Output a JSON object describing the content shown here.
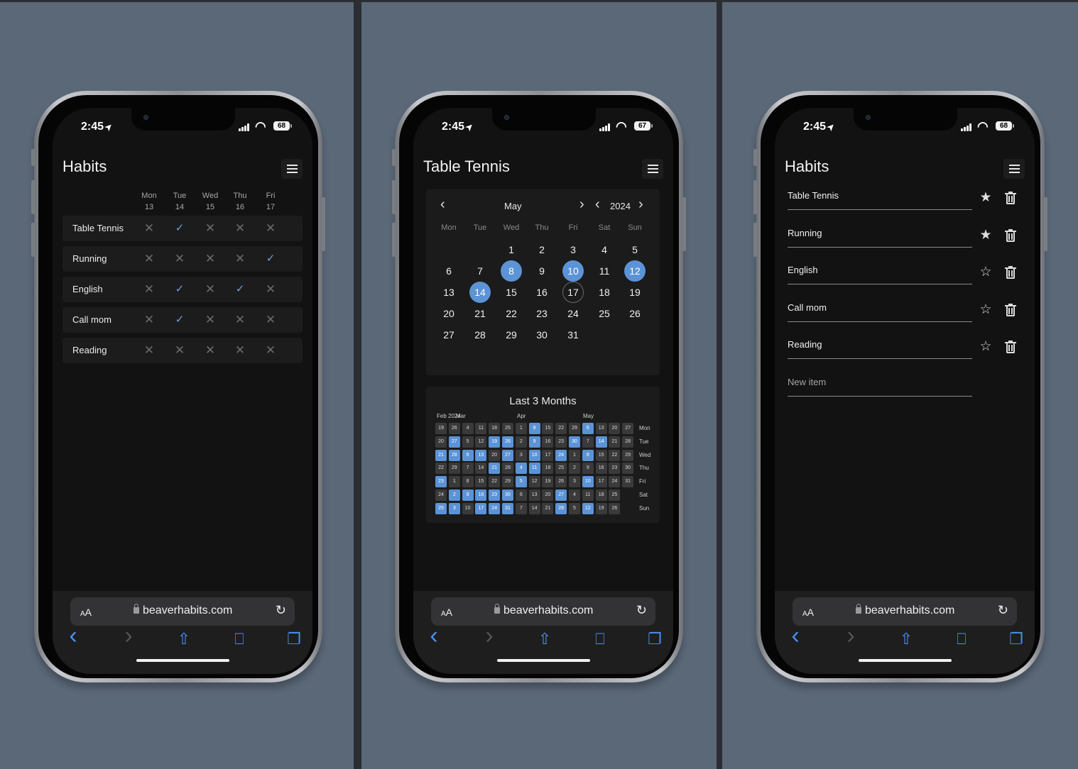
{
  "status": {
    "time": "2:45",
    "location_icon": "location-arrow-icon",
    "batteries": [
      "68",
      "67",
      "68"
    ]
  },
  "safari": {
    "aa_big": "A",
    "aa_small": "A",
    "url": "beaverhabits.com",
    "reload_icon": "reload-icon"
  },
  "screen1": {
    "title": "Habits",
    "days": [
      {
        "name": "Mon",
        "num": "13"
      },
      {
        "name": "Tue",
        "num": "14"
      },
      {
        "name": "Wed",
        "num": "15"
      },
      {
        "name": "Thu",
        "num": "16"
      },
      {
        "name": "Fri",
        "num": "17"
      }
    ],
    "habits": [
      {
        "name": "Table Tennis",
        "checks": [
          false,
          true,
          false,
          false,
          false
        ]
      },
      {
        "name": "Running",
        "checks": [
          false,
          false,
          false,
          false,
          true
        ]
      },
      {
        "name": "English",
        "checks": [
          false,
          true,
          false,
          true,
          false
        ]
      },
      {
        "name": "Call mom",
        "checks": [
          false,
          true,
          false,
          false,
          false
        ]
      },
      {
        "name": "Reading",
        "checks": [
          false,
          false,
          false,
          false,
          false
        ]
      }
    ]
  },
  "screen2": {
    "title": "Table Tennis",
    "calendar": {
      "month": "May",
      "year": "2024",
      "weekdays": [
        "Mon",
        "Tue",
        "Wed",
        "Thu",
        "Fri",
        "Sat",
        "Sun"
      ],
      "weeks": [
        [
          "",
          "",
          "1",
          "2",
          "3",
          "4",
          "5"
        ],
        [
          "6",
          "7",
          "8",
          "9",
          "10",
          "11",
          "12"
        ],
        [
          "13",
          "14",
          "15",
          "16",
          "17",
          "18",
          "19"
        ],
        [
          "20",
          "21",
          "22",
          "23",
          "24",
          "25",
          "26"
        ],
        [
          "27",
          "28",
          "29",
          "30",
          "31",
          "",
          ""
        ]
      ],
      "selected": [
        "8",
        "10",
        "12",
        "14"
      ],
      "today": "17"
    },
    "heatmap": {
      "title": "Last 3 Months",
      "month_labels": [
        "Feb 2024",
        "Mar",
        "Apr",
        "May"
      ],
      "day_labels": [
        "Mon",
        "Tue",
        "Wed",
        "Thu",
        "Fri",
        "Sat",
        "Sun"
      ],
      "rows": [
        [
          "19",
          "26",
          "4",
          "11",
          "18",
          "25",
          "1",
          "8",
          "15",
          "22",
          "29",
          "6",
          "13",
          "20",
          "27"
        ],
        [
          "20",
          "27",
          "5",
          "12",
          "19",
          "26",
          "2",
          "9",
          "16",
          "23",
          "30",
          "7",
          "14",
          "21",
          "28"
        ],
        [
          "21",
          "28",
          "6",
          "13",
          "20",
          "27",
          "3",
          "10",
          "17",
          "24",
          "1",
          "8",
          "15",
          "22",
          "29"
        ],
        [
          "22",
          "29",
          "7",
          "14",
          "21",
          "28",
          "4",
          "11",
          "18",
          "25",
          "2",
          "9",
          "16",
          "23",
          "30"
        ],
        [
          "23",
          "1",
          "8",
          "15",
          "22",
          "29",
          "5",
          "12",
          "19",
          "26",
          "3",
          "10",
          "17",
          "24",
          "31"
        ],
        [
          "24",
          "2",
          "9",
          "16",
          "23",
          "30",
          "6",
          "13",
          "20",
          "27",
          "4",
          "11",
          "18",
          "25",
          ""
        ],
        [
          "25",
          "3",
          "10",
          "17",
          "24",
          "31",
          "7",
          "14",
          "21",
          "28",
          "5",
          "12",
          "19",
          "26",
          ""
        ]
      ],
      "highlighted": [
        [
          7,
          11
        ],
        [
          1,
          4,
          5,
          7,
          10,
          12
        ],
        [
          0,
          1,
          2,
          3,
          5,
          7,
          9,
          11
        ],
        [
          4,
          6,
          7
        ],
        [
          0,
          6,
          11
        ],
        [
          1,
          2,
          3,
          4,
          5,
          9
        ],
        [
          0,
          1,
          3,
          4,
          5,
          9,
          11
        ]
      ]
    }
  },
  "screen3": {
    "title": "Habits",
    "items": [
      {
        "name": "Table Tennis",
        "starred": true
      },
      {
        "name": "Running",
        "starred": true
      },
      {
        "name": "English",
        "starred": false
      },
      {
        "name": "Call mom",
        "starred": false
      },
      {
        "name": "Reading",
        "starred": false
      }
    ],
    "new_item_placeholder": "New item"
  },
  "colors": {
    "accent": "#5b93d6",
    "check": "#6fa0e0",
    "background": "#5b6878",
    "screen": "#121212"
  }
}
